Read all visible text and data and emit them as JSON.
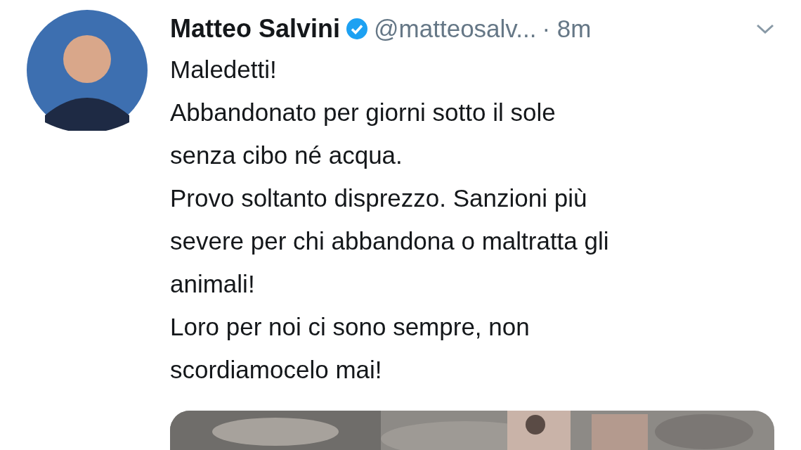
{
  "tweet": {
    "author_name": "Matteo Salvini",
    "verified": true,
    "handle": "@matteosalv...",
    "time": "· 8m",
    "paragraphs": [
      "Maledetti!",
      "Abbandonato per giorni sotto il sole\nsenza cibo né acqua.",
      "Provo soltanto disprezzo. Sanzioni più\nsevere per chi abbandona o maltratta gli\nanimali!",
      "Loro per noi ci sono sempre, non\nscordiamocelo mai!"
    ]
  }
}
